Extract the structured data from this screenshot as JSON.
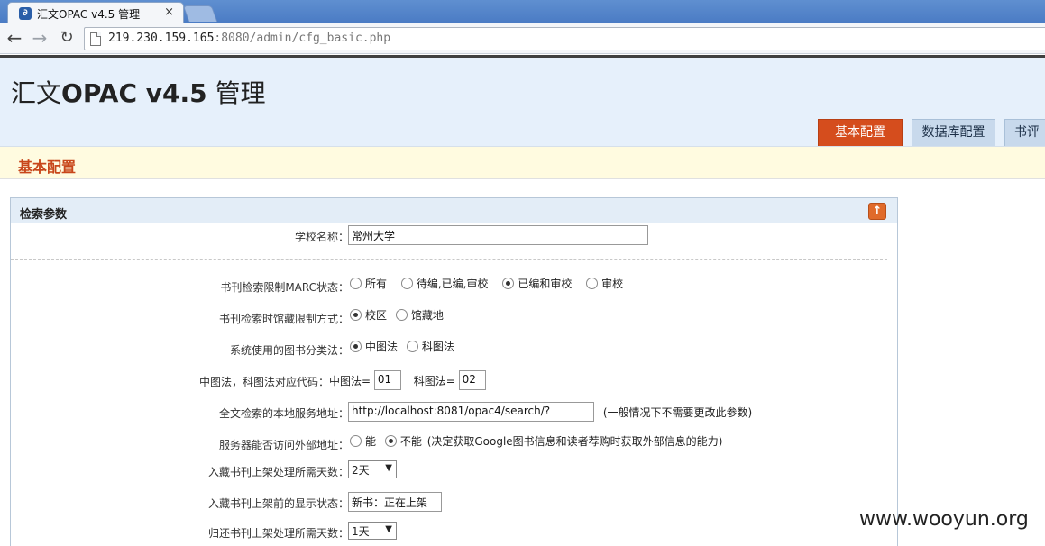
{
  "browser": {
    "tab_title": "汇文OPAC v4.5 管理",
    "tab_close": "×",
    "url_host": "219.230.159.165",
    "url_rest": ":8080/admin/cfg_basic.php"
  },
  "header": {
    "title_prefix": "汇文",
    "title_latin": "OPAC v4.5",
    "title_suffix": " 管理",
    "nav_tabs": [
      "基本配置",
      "数据库配置",
      "书评"
    ]
  },
  "section": {
    "title": "基本配置"
  },
  "panel": {
    "title": "检索参数",
    "collapse_icon": "↑",
    "school": {
      "label": "学校名称：",
      "value": "常州大学"
    },
    "marc": {
      "label": "书刊检索限制MARC状态：",
      "options": [
        "所有",
        "待编,已编,审校",
        "已编和审校",
        "审校"
      ],
      "selected": "已编和审校"
    },
    "location": {
      "label": "书刊检索时馆藏限制方式：",
      "options": [
        "校区",
        "馆藏地"
      ],
      "selected": "校区"
    },
    "classification": {
      "label": "系统使用的图书分类法：",
      "options": [
        "中图法",
        "科图法"
      ],
      "selected": "中图法"
    },
    "codes": {
      "label": "中图法，科图法对应代码：",
      "zt_label": "中图法=",
      "zt_value": "01",
      "kt_label": "科图法=",
      "kt_value": "02"
    },
    "fulltext": {
      "label": "全文检索的本地服务地址：",
      "value": "http://localhost:8081/opac4/search/?",
      "hint": "(一般情况下不需要更改此参数)"
    },
    "external": {
      "label": "服务器能否访问外部地址：",
      "options": [
        "能",
        "不能"
      ],
      "selected": "不能",
      "hint": "(决定获取Google图书信息和读者荐购时获取外部信息的能力)"
    },
    "shelving_days": {
      "label": "入藏书刊上架处理所需天数：",
      "value": "2天"
    },
    "shelving_status": {
      "label": "入藏书刊上架前的显示状态：",
      "value": "新书：正在上架"
    },
    "return_days": {
      "label": "归还书刊上架处理所需天数：",
      "value": "1天"
    }
  },
  "watermark": "www.wooyun.org",
  "colors": {
    "accent": "#d54d1d",
    "header_bg": "#e6f0fb",
    "section_bg": "#fffbe0"
  }
}
